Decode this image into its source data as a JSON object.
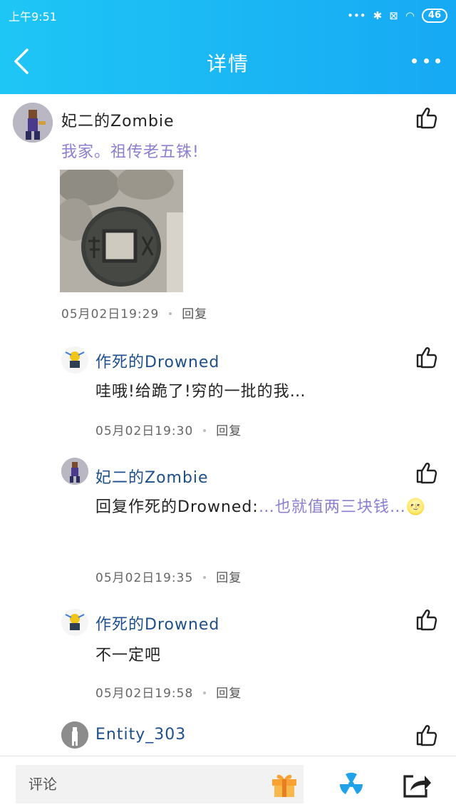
{
  "status_bar": {
    "time": "上午9:51",
    "battery": "46"
  },
  "nav": {
    "title": "详情"
  },
  "main_post": {
    "author": "妃二的Zombie",
    "text": "我家。祖传老五铢!",
    "timestamp": "05月02日19:29",
    "reply_label": "回复"
  },
  "replies": [
    {
      "author": "作死的Drowned",
      "text": "哇哦!给跪了!穷的一批的我…",
      "timestamp": "05月02日19:30",
      "reply_label": "回复"
    },
    {
      "author": "妃二的Zombie",
      "text_prefix": "回复作死的Drowned:",
      "text_quote": "…也就值两三块钱…",
      "emoji": "🌝",
      "timestamp": "05月02日19:35",
      "reply_label": "回复"
    },
    {
      "author": "作死的Drowned",
      "text": "不一定吧",
      "timestamp": "05月02日19:58",
      "reply_label": "回复"
    },
    {
      "author": "Entity_303"
    }
  ],
  "bottom_bar": {
    "comment_placeholder": "评论"
  },
  "colors": {
    "accent": "#17a9f4",
    "quote": "#8a7fd1",
    "username": "#1d4f8c"
  }
}
